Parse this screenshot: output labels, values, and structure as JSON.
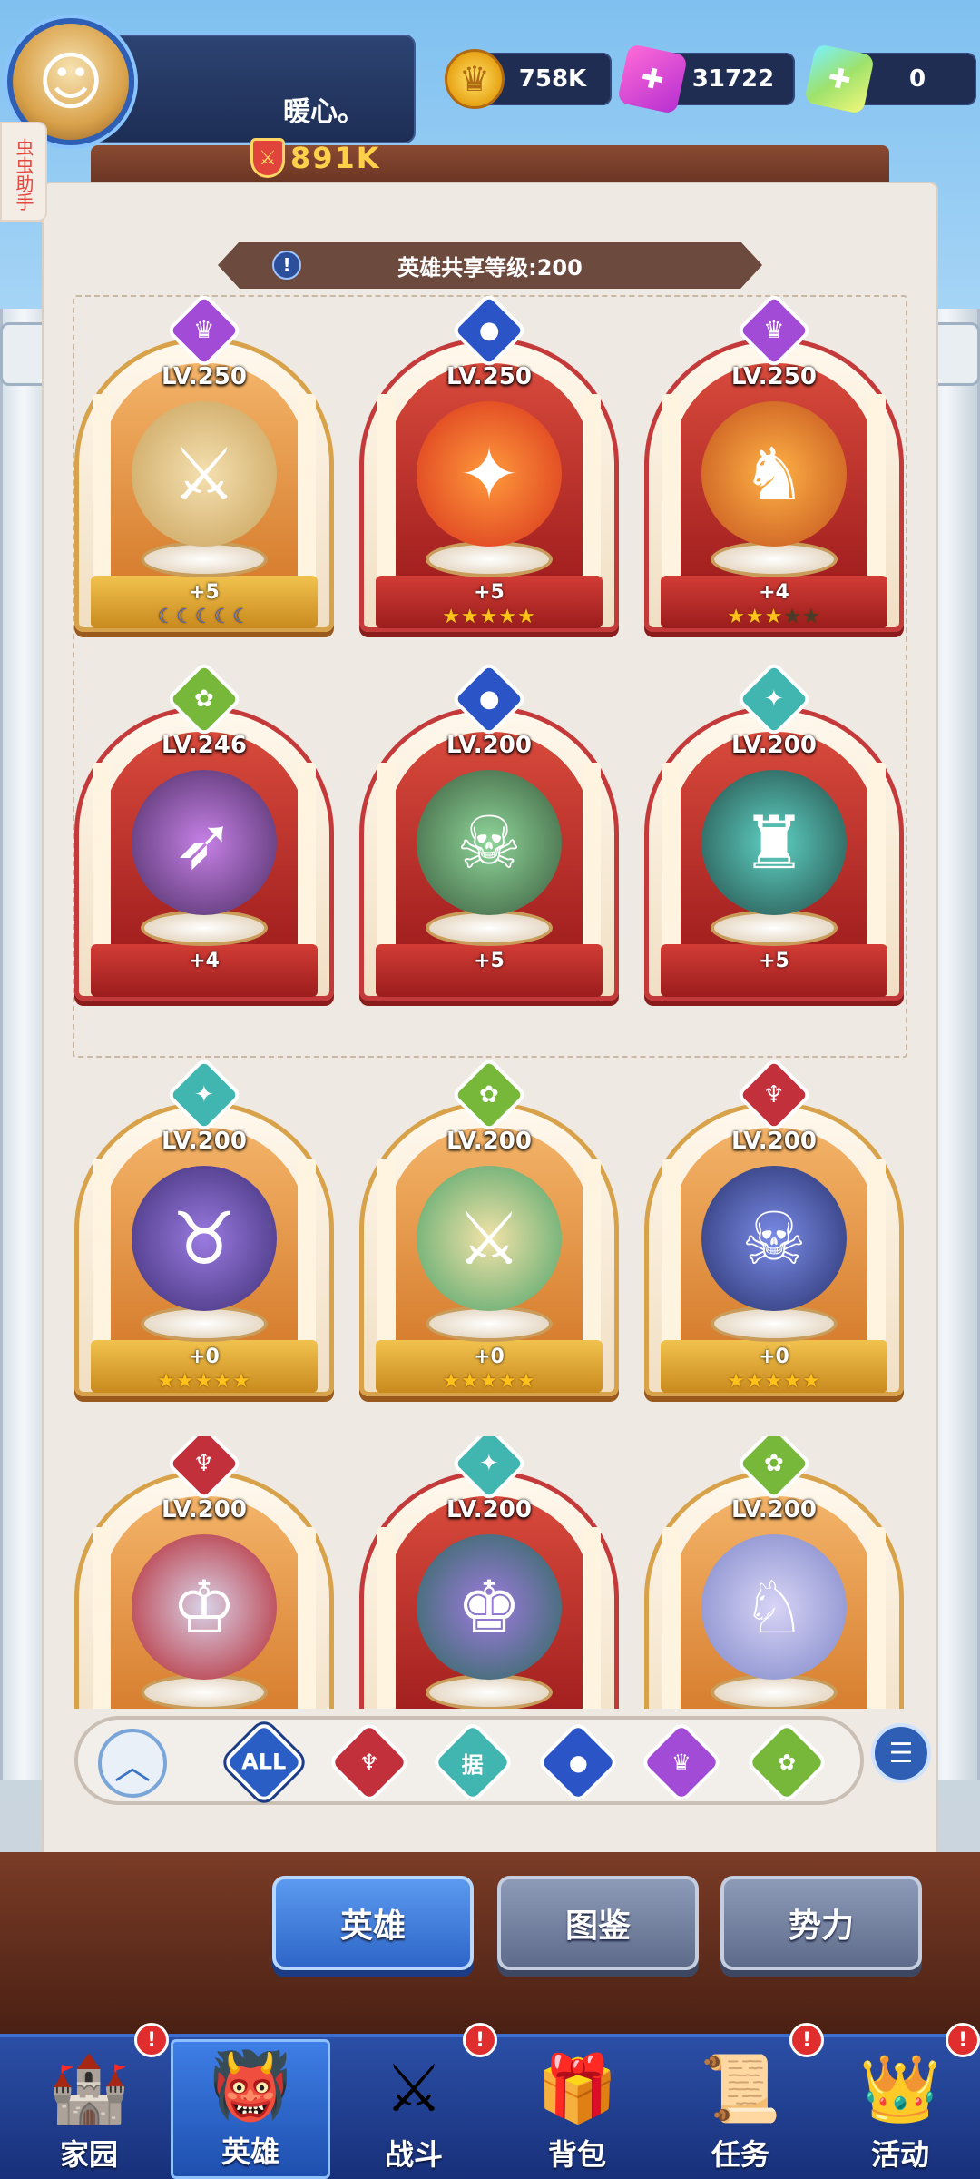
{
  "player": {
    "name": "暖心。",
    "power": "891K"
  },
  "side_tag": "虫虫助手",
  "currencies": {
    "gold": "758K",
    "gems": "31722",
    "crystals": "0"
  },
  "shared_level_text": "英雄共享等级:200",
  "heroes": [
    {
      "level": "LV.250",
      "plus": "+5",
      "faction": "purple",
      "stars": "☾☾☾☾☾"
    },
    {
      "level": "LV.250",
      "plus": "+5",
      "faction": "blue",
      "stars": "★★★★★"
    },
    {
      "level": "LV.250",
      "plus": "+4",
      "faction": "purple",
      "stars_on": "★★★",
      "stars_off": "★★"
    },
    {
      "level": "LV.246",
      "plus": "+4",
      "faction": "green"
    },
    {
      "level": "LV.200",
      "plus": "+5",
      "faction": "blue"
    },
    {
      "level": "LV.200",
      "plus": "+5",
      "faction": "teal"
    },
    {
      "level": "LV.200",
      "plus": "+0",
      "faction": "teal",
      "stars": "★★★★★"
    },
    {
      "level": "LV.200",
      "plus": "+0",
      "faction": "green",
      "stars": "★★★★★"
    },
    {
      "level": "LV.200",
      "plus": "+0",
      "faction": "red",
      "stars": "★★★★★"
    },
    {
      "level": "LV.200",
      "faction": "red"
    },
    {
      "level": "LV.200",
      "faction": "teal"
    },
    {
      "level": "LV.200",
      "faction": "green"
    }
  ],
  "filters": {
    "all_label": "ALL",
    "teal_glyph": "据"
  },
  "tabs": {
    "heroes": "英雄",
    "codex": "图鉴",
    "factions": "势力"
  },
  "nav": {
    "home": "家园",
    "heroes": "英雄",
    "battle": "战斗",
    "bag": "背包",
    "tasks": "任务",
    "events": "活动",
    "badge": "!"
  }
}
